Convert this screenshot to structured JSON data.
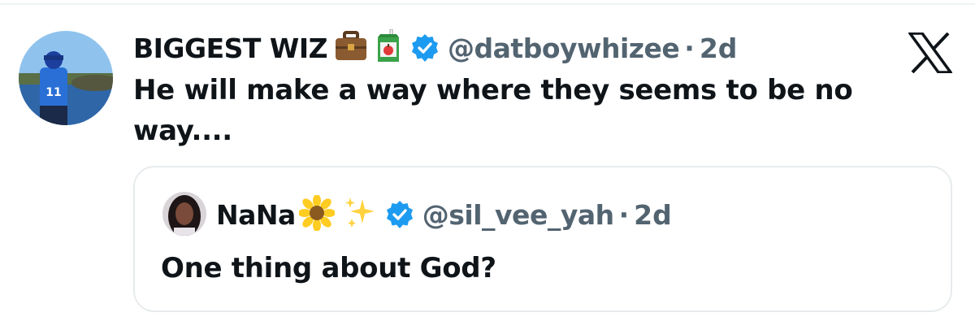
{
  "post": {
    "display_name": "BIGGEST WIZ",
    "name_emojis": [
      "briefcase-icon",
      "juice-box-icon"
    ],
    "verified": true,
    "handle": "@datboywhizee",
    "separator": "·",
    "time": "2d",
    "text": "He will make a way where they seems to be no way...."
  },
  "quote": {
    "display_name": "NaNa",
    "name_emojis": [
      "sunflower-icon",
      "sparkles-icon"
    ],
    "verified": true,
    "handle": "@sil_vee_yah",
    "separator": "·",
    "time": "2d",
    "text": "One thing about God?"
  },
  "branding": {
    "logo": "x-logo-icon"
  },
  "colors": {
    "text": "#0f1419",
    "secondary": "#536471",
    "verified_blue": "#1d9bf0",
    "border": "#e7ebed"
  }
}
